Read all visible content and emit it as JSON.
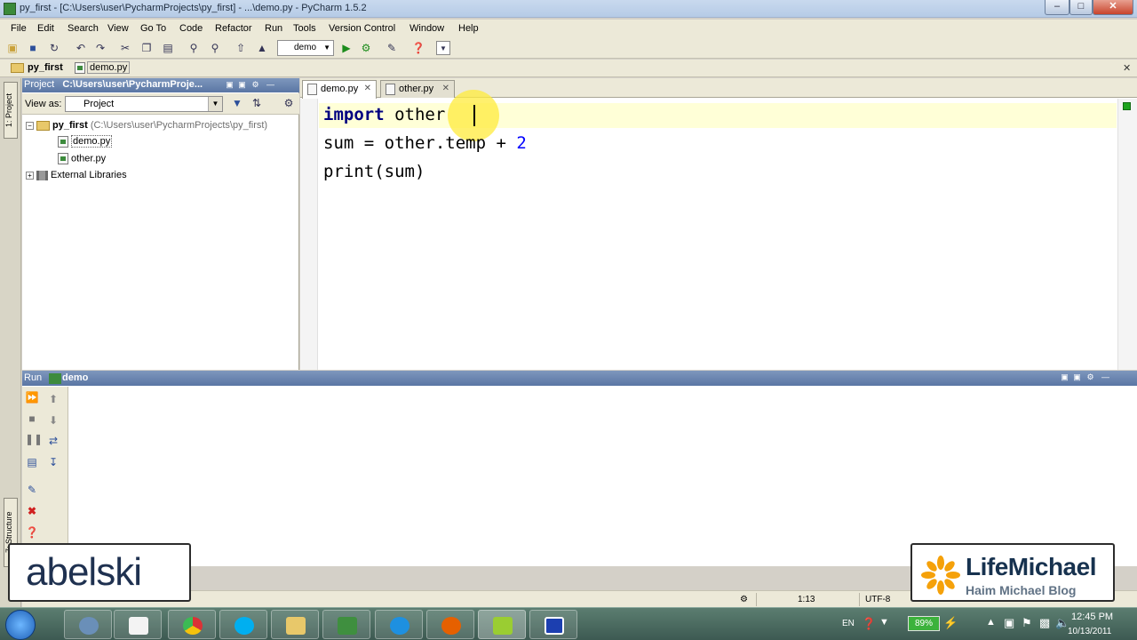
{
  "window": {
    "title": "py_first - [C:\\Users\\user\\PycharmProjects\\py_first] - ...\\demo.py - PyCharm 1.5.2",
    "minimize": "–",
    "maximize": "□",
    "close": "✕"
  },
  "menu": [
    "File",
    "Edit",
    "Search",
    "View",
    "Go To",
    "Code",
    "Refactor",
    "Run",
    "Tools",
    "Version Control",
    "Window",
    "Help"
  ],
  "toolbar": {
    "run_config": "demo"
  },
  "navbar": {
    "crumb1": "py_first",
    "crumb2": "demo.py",
    "close": "✕"
  },
  "left_strip": {
    "tab_project": "1: Project",
    "tab_structure": "7: Structure"
  },
  "project_panel": {
    "title_prefix": "Project",
    "title_path": "C:\\Users\\user\\PycharmProje...",
    "view_as_label": "View as:",
    "view_as_value": "Project",
    "tree": {
      "root_name": "py_first",
      "root_path": "(C:\\Users\\user\\PycharmProjects\\py_first)",
      "file1": "demo.py",
      "file2": "other.py",
      "libs": "External Libraries"
    }
  },
  "editor": {
    "tabs": [
      {
        "label": "demo.py",
        "active": true
      },
      {
        "label": "other.py",
        "active": false
      }
    ],
    "tab_close": "✕",
    "lines": {
      "l1_kw": "import",
      "l1_rest": " other",
      "l2_a": "sum = other.temp + ",
      "l2_num": "2",
      "l3": "print(sum)"
    }
  },
  "run_panel": {
    "label": "Run",
    "config": "demo"
  },
  "status": {
    "position": "1:13",
    "encoding": "UTF-8"
  },
  "taskbar": {
    "lang": "EN",
    "battery": "89%",
    "time": "12:45 PM",
    "date": "10/13/2011"
  },
  "overlays": {
    "left_logo": "abelski",
    "right_logo_name": "LifeMichael",
    "right_logo_sub": "Haim Michael Blog"
  },
  "colors": {
    "keyword": "#000080",
    "number": "#0000ff",
    "caret_line": "#ffffd7",
    "panel_header": "#6a85b1"
  }
}
